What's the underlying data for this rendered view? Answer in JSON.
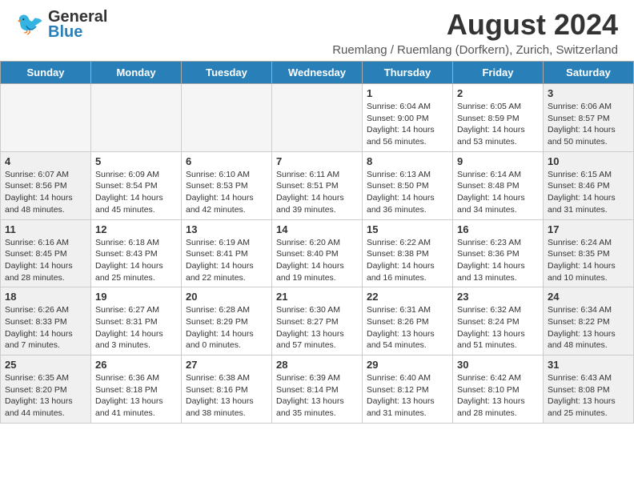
{
  "header": {
    "logo_general": "General",
    "logo_blue": "Blue",
    "month_year": "August 2024",
    "location": "Ruemlang / Ruemlang (Dorfkern), Zurich, Switzerland"
  },
  "weekdays": [
    "Sunday",
    "Monday",
    "Tuesday",
    "Wednesday",
    "Thursday",
    "Friday",
    "Saturday"
  ],
  "rows": [
    {
      "cells": [
        {
          "day": "",
          "info": "",
          "empty": true
        },
        {
          "day": "",
          "info": "",
          "empty": true
        },
        {
          "day": "",
          "info": "",
          "empty": true
        },
        {
          "day": "",
          "info": "",
          "empty": true
        },
        {
          "day": "1",
          "info": "Sunrise: 6:04 AM\nSunset: 9:00 PM\nDaylight: 14 hours\nand 56 minutes.",
          "empty": false
        },
        {
          "day": "2",
          "info": "Sunrise: 6:05 AM\nSunset: 8:59 PM\nDaylight: 14 hours\nand 53 minutes.",
          "empty": false
        },
        {
          "day": "3",
          "info": "Sunrise: 6:06 AM\nSunset: 8:57 PM\nDaylight: 14 hours\nand 50 minutes.",
          "empty": false,
          "shaded": true
        }
      ]
    },
    {
      "cells": [
        {
          "day": "4",
          "info": "Sunrise: 6:07 AM\nSunset: 8:56 PM\nDaylight: 14 hours\nand 48 minutes.",
          "empty": false,
          "shaded": true
        },
        {
          "day": "5",
          "info": "Sunrise: 6:09 AM\nSunset: 8:54 PM\nDaylight: 14 hours\nand 45 minutes.",
          "empty": false
        },
        {
          "day": "6",
          "info": "Sunrise: 6:10 AM\nSunset: 8:53 PM\nDaylight: 14 hours\nand 42 minutes.",
          "empty": false
        },
        {
          "day": "7",
          "info": "Sunrise: 6:11 AM\nSunset: 8:51 PM\nDaylight: 14 hours\nand 39 minutes.",
          "empty": false
        },
        {
          "day": "8",
          "info": "Sunrise: 6:13 AM\nSunset: 8:50 PM\nDaylight: 14 hours\nand 36 minutes.",
          "empty": false
        },
        {
          "day": "9",
          "info": "Sunrise: 6:14 AM\nSunset: 8:48 PM\nDaylight: 14 hours\nand 34 minutes.",
          "empty": false
        },
        {
          "day": "10",
          "info": "Sunrise: 6:15 AM\nSunset: 8:46 PM\nDaylight: 14 hours\nand 31 minutes.",
          "empty": false,
          "shaded": true
        }
      ]
    },
    {
      "cells": [
        {
          "day": "11",
          "info": "Sunrise: 6:16 AM\nSunset: 8:45 PM\nDaylight: 14 hours\nand 28 minutes.",
          "empty": false,
          "shaded": true
        },
        {
          "day": "12",
          "info": "Sunrise: 6:18 AM\nSunset: 8:43 PM\nDaylight: 14 hours\nand 25 minutes.",
          "empty": false
        },
        {
          "day": "13",
          "info": "Sunrise: 6:19 AM\nSunset: 8:41 PM\nDaylight: 14 hours\nand 22 minutes.",
          "empty": false
        },
        {
          "day": "14",
          "info": "Sunrise: 6:20 AM\nSunset: 8:40 PM\nDaylight: 14 hours\nand 19 minutes.",
          "empty": false
        },
        {
          "day": "15",
          "info": "Sunrise: 6:22 AM\nSunset: 8:38 PM\nDaylight: 14 hours\nand 16 minutes.",
          "empty": false
        },
        {
          "day": "16",
          "info": "Sunrise: 6:23 AM\nSunset: 8:36 PM\nDaylight: 14 hours\nand 13 minutes.",
          "empty": false
        },
        {
          "day": "17",
          "info": "Sunrise: 6:24 AM\nSunset: 8:35 PM\nDaylight: 14 hours\nand 10 minutes.",
          "empty": false,
          "shaded": true
        }
      ]
    },
    {
      "cells": [
        {
          "day": "18",
          "info": "Sunrise: 6:26 AM\nSunset: 8:33 PM\nDaylight: 14 hours\nand 7 minutes.",
          "empty": false,
          "shaded": true
        },
        {
          "day": "19",
          "info": "Sunrise: 6:27 AM\nSunset: 8:31 PM\nDaylight: 14 hours\nand 3 minutes.",
          "empty": false
        },
        {
          "day": "20",
          "info": "Sunrise: 6:28 AM\nSunset: 8:29 PM\nDaylight: 14 hours\nand 0 minutes.",
          "empty": false
        },
        {
          "day": "21",
          "info": "Sunrise: 6:30 AM\nSunset: 8:27 PM\nDaylight: 13 hours\nand 57 minutes.",
          "empty": false
        },
        {
          "day": "22",
          "info": "Sunrise: 6:31 AM\nSunset: 8:26 PM\nDaylight: 13 hours\nand 54 minutes.",
          "empty": false
        },
        {
          "day": "23",
          "info": "Sunrise: 6:32 AM\nSunset: 8:24 PM\nDaylight: 13 hours\nand 51 minutes.",
          "empty": false
        },
        {
          "day": "24",
          "info": "Sunrise: 6:34 AM\nSunset: 8:22 PM\nDaylight: 13 hours\nand 48 minutes.",
          "empty": false,
          "shaded": true
        }
      ]
    },
    {
      "cells": [
        {
          "day": "25",
          "info": "Sunrise: 6:35 AM\nSunset: 8:20 PM\nDaylight: 13 hours\nand 44 minutes.",
          "empty": false,
          "shaded": true
        },
        {
          "day": "26",
          "info": "Sunrise: 6:36 AM\nSunset: 8:18 PM\nDaylight: 13 hours\nand 41 minutes.",
          "empty": false
        },
        {
          "day": "27",
          "info": "Sunrise: 6:38 AM\nSunset: 8:16 PM\nDaylight: 13 hours\nand 38 minutes.",
          "empty": false
        },
        {
          "day": "28",
          "info": "Sunrise: 6:39 AM\nSunset: 8:14 PM\nDaylight: 13 hours\nand 35 minutes.",
          "empty": false
        },
        {
          "day": "29",
          "info": "Sunrise: 6:40 AM\nSunset: 8:12 PM\nDaylight: 13 hours\nand 31 minutes.",
          "empty": false
        },
        {
          "day": "30",
          "info": "Sunrise: 6:42 AM\nSunset: 8:10 PM\nDaylight: 13 hours\nand 28 minutes.",
          "empty": false
        },
        {
          "day": "31",
          "info": "Sunrise: 6:43 AM\nSunset: 8:08 PM\nDaylight: 13 hours\nand 25 minutes.",
          "empty": false,
          "shaded": true
        }
      ]
    }
  ]
}
